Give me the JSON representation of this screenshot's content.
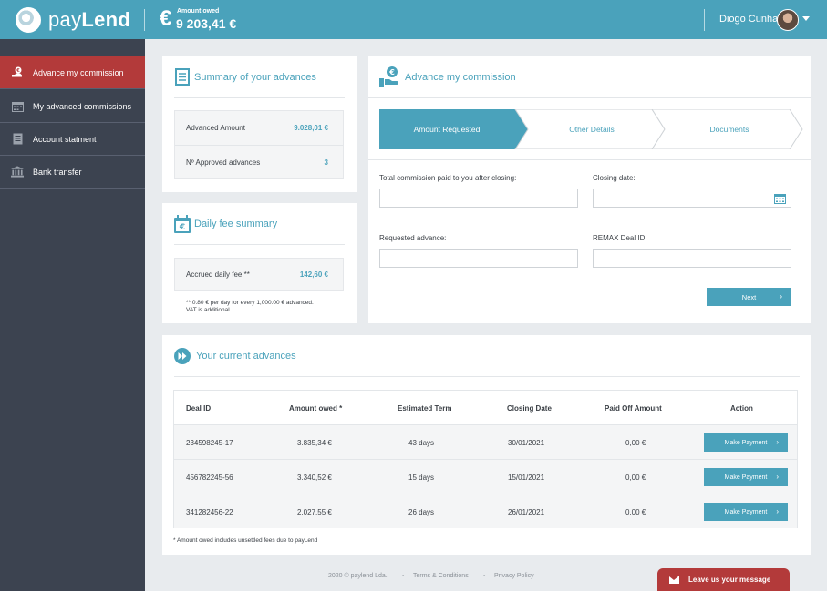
{
  "brand": {
    "name_a": "pay",
    "name_b": "Lend"
  },
  "header": {
    "currency_symbol": "€",
    "amount_owed_label": "Amount owed",
    "amount_owed_value": "9 203,41 €",
    "user_name": "Diogo Cunha"
  },
  "sidebar": {
    "items": [
      {
        "label": "Advance my commission",
        "icon": "hand-euro-icon",
        "active": true
      },
      {
        "label": "My advanced commissions",
        "icon": "calendar-icon",
        "active": false
      },
      {
        "label": "Account statment",
        "icon": "document-icon",
        "active": false
      },
      {
        "label": "Bank transfer",
        "icon": "bank-icon",
        "active": false
      }
    ]
  },
  "summary": {
    "title": "Summary of your advances",
    "rows": [
      {
        "label": "Advanced Amount",
        "value": "9.028,01 €"
      },
      {
        "label": "Nº Approved advances",
        "value": "3"
      }
    ]
  },
  "daily_fee": {
    "title": "Daily fee summary",
    "label": "Accrued daily fee **",
    "value": "142,60 €",
    "note_line1": "** 0.80 € per day for every 1,000.00 € advanced.",
    "note_line2": "VAT is additional."
  },
  "advance": {
    "title": "Advance my commission",
    "steps": [
      "Amount Requested",
      "Other Details",
      "Documents"
    ],
    "fields": {
      "total_commission_label": "Total commission paid to you after closing:",
      "closing_date_label": "Closing date:",
      "requested_advance_label": "Requested advance:",
      "remax_deal_label": "REMAX Deal ID:"
    },
    "next_label": "Next"
  },
  "advances_table": {
    "title": "Your current advances",
    "columns": [
      "Deal ID",
      "Amount owed *",
      "Estimated Term",
      "Closing Date",
      "Paid Off Amount",
      "Action"
    ],
    "rows": [
      [
        "234598245-17",
        "3.835,34 €",
        "43 days",
        "30/01/2021",
        "0,00 €",
        "Make Payment"
      ],
      [
        "456782245-56",
        "3.340,52 €",
        "15 days",
        "15/01/2021",
        "0,00 €",
        "Make Payment"
      ],
      [
        "341282456-22",
        "2.027,55 €",
        "26 days",
        "26/01/2021",
        "0,00 €",
        "Make Payment"
      ]
    ],
    "note": "* Amount owed includes unsettled fees due to payLend"
  },
  "footer": {
    "copyright": "2020 © paylend Lda.",
    "sep": "-",
    "terms": "Terms & Conditions",
    "privacy": "Privacy Policy",
    "chat_label": "Leave us your message"
  },
  "colors": {
    "accent": "#4aa2bb",
    "active": "#b33a3a",
    "sidebar": "#3c4350"
  }
}
